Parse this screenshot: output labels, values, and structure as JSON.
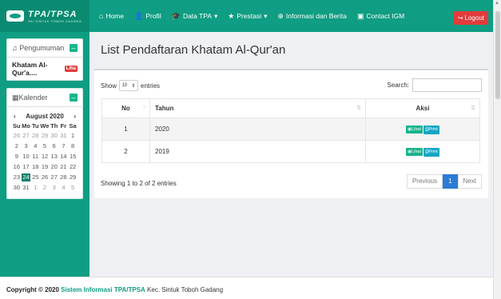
{
  "brand": {
    "title": "TPA/TPSA",
    "subtitle": "SKI SINTUK TOBOH GADANG"
  },
  "nav": {
    "items": [
      {
        "icon": "home-icon",
        "label": "Home"
      },
      {
        "icon": "users-icon",
        "label": "Profil"
      },
      {
        "icon": "graduation-cap-icon",
        "label": "Data TPA",
        "dropdown": true
      },
      {
        "icon": "star-icon",
        "label": "Prestasi",
        "dropdown": true
      },
      {
        "icon": "globe-icon",
        "label": "Informasi dan Berita"
      },
      {
        "icon": "contact-card-icon",
        "label": "Contact IGM"
      }
    ],
    "logout": "Logout"
  },
  "sidebar": {
    "announcement": {
      "title": "Pengumuman",
      "item": "Khatam Al-Qur'a....",
      "badge": "Liha"
    },
    "calendar": {
      "title": "Kalender",
      "month": "August 2020",
      "dows": [
        "Su",
        "Mo",
        "Tu",
        "We",
        "Th",
        "Fr",
        "Sa"
      ],
      "days": [
        {
          "d": "26",
          "m": true
        },
        {
          "d": "27",
          "m": true
        },
        {
          "d": "28",
          "m": true
        },
        {
          "d": "29",
          "m": true
        },
        {
          "d": "30",
          "m": true
        },
        {
          "d": "31",
          "m": true
        },
        {
          "d": "1"
        },
        {
          "d": "2"
        },
        {
          "d": "3"
        },
        {
          "d": "4"
        },
        {
          "d": "5"
        },
        {
          "d": "6"
        },
        {
          "d": "7"
        },
        {
          "d": "8"
        },
        {
          "d": "9"
        },
        {
          "d": "10"
        },
        {
          "d": "11"
        },
        {
          "d": "12"
        },
        {
          "d": "13"
        },
        {
          "d": "14"
        },
        {
          "d": "15"
        },
        {
          "d": "16"
        },
        {
          "d": "17"
        },
        {
          "d": "18"
        },
        {
          "d": "19"
        },
        {
          "d": "20"
        },
        {
          "d": "21"
        },
        {
          "d": "22"
        },
        {
          "d": "23"
        },
        {
          "d": "24",
          "today": true
        },
        {
          "d": "25"
        },
        {
          "d": "26"
        },
        {
          "d": "27"
        },
        {
          "d": "28"
        },
        {
          "d": "29"
        },
        {
          "d": "30"
        },
        {
          "d": "31"
        },
        {
          "d": "1",
          "m": true
        },
        {
          "d": "2",
          "m": true
        },
        {
          "d": "3",
          "m": true
        },
        {
          "d": "4",
          "m": true
        },
        {
          "d": "5",
          "m": true
        }
      ]
    }
  },
  "main": {
    "title": "List Pendaftaran Khatam Al-Qur'an",
    "show_label": "Show",
    "entries_value": "10",
    "entries_label": "entries",
    "search_label": "Search:",
    "columns": {
      "no": "No",
      "tahun": "Tahun",
      "aksi": "Aksi"
    },
    "rows": [
      {
        "no": "1",
        "tahun": "2020"
      },
      {
        "no": "2",
        "tahun": "2019"
      }
    ],
    "btn_lihat": "Lihat",
    "btn_print": "Print",
    "info": "Showing 1 to 2 of 2 entries",
    "pager": {
      "prev": "Previous",
      "page": "1",
      "next": "Next"
    }
  },
  "footer": {
    "prefix": "Copyright © 2020",
    "app": "Sistem Informasi TPA/TPSA",
    "location": "Kec. Sintuk Toboh Gadang"
  },
  "colors": {
    "primary": "#0f9d83",
    "logout": "#e23b3b",
    "page_active": "#2b7bd4"
  }
}
